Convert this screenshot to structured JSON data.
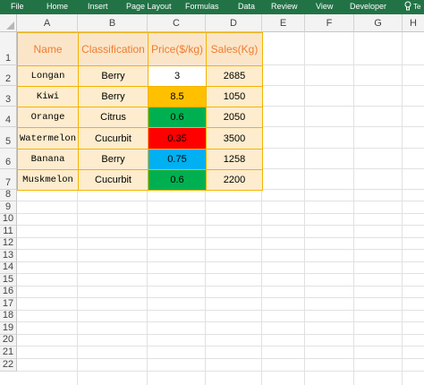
{
  "ribbon": {
    "tabs": [
      "File",
      "Home",
      "Insert",
      "Page Layout",
      "Formulas",
      "Data",
      "Review",
      "View",
      "Developer"
    ],
    "tell_me": "Te",
    "color": "#217346"
  },
  "columns": [
    "A",
    "B",
    "C",
    "D",
    "E",
    "F",
    "G",
    "H"
  ],
  "rows": [
    "1",
    "2",
    "3",
    "4",
    "5",
    "6",
    "7",
    "8",
    "9",
    "10",
    "11",
    "12",
    "13",
    "14",
    "15",
    "16",
    "17",
    "18",
    "19",
    "20",
    "21",
    "22"
  ],
  "table": {
    "headers": [
      "Name",
      "Classification",
      "Price($/kg)",
      "Sales(Kg)"
    ],
    "rows": [
      [
        "Longan",
        "Berry",
        "3",
        "2685"
      ],
      [
        "Kiwi",
        "Berry",
        "8.5",
        "1050"
      ],
      [
        "Orange",
        "Citrus",
        "0.6",
        "2050"
      ],
      [
        "Watermelon",
        "Cucurbit",
        "0.35",
        "3500"
      ],
      [
        "Banana",
        "Berry",
        "0.75",
        "1258"
      ],
      [
        "Muskmelon",
        "Cucurbit",
        "0.6",
        "2200"
      ]
    ],
    "price_fill_colors": [
      "#ffffff",
      "#ffc000",
      "#00b050",
      "#ff0000",
      "#00b0f0",
      "#00b050"
    ],
    "header_fill": "#fbe5c8",
    "header_text_color": "#ed7d31",
    "body_fill": "#fdeccd",
    "border_color": "#f4b400"
  }
}
